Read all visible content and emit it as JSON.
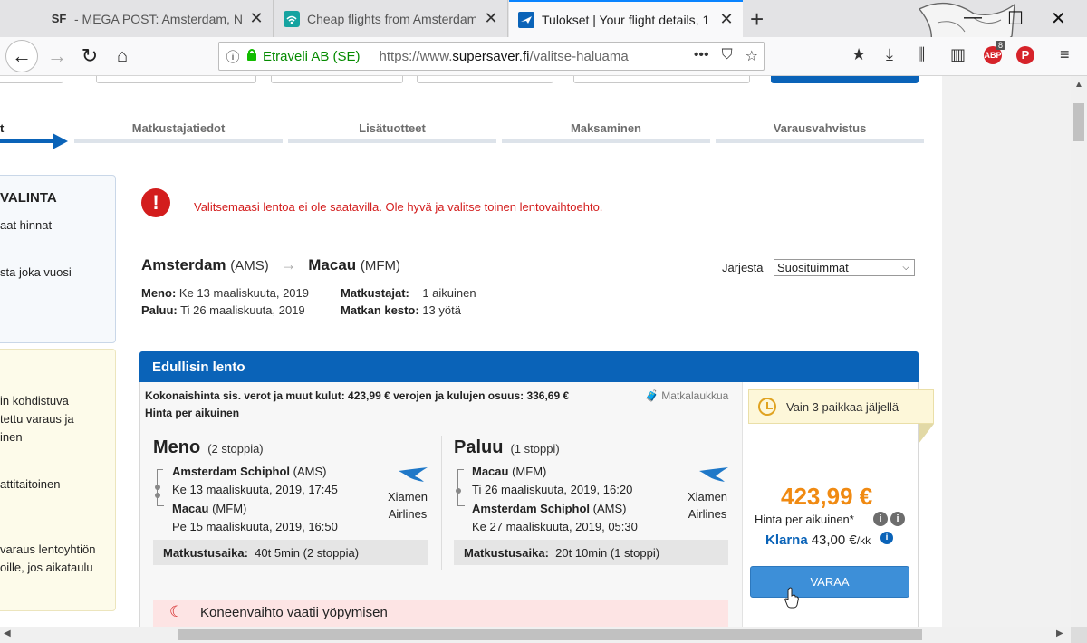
{
  "browser": {
    "tabs": [
      {
        "favicon": "SF",
        "title": "- MEGA POST: Amsterdam, Net"
      },
      {
        "favicon": "wifi-icon",
        "title": "Cheap flights from Amsterdam"
      },
      {
        "favicon": "plane-icon",
        "title": "Tulokset | Your flight details, 1"
      }
    ],
    "site_identity": "Etraveli AB (SE)",
    "url_prefix": "https://www.",
    "url_domain": "supersaver.fi",
    "url_path": "/valitse-haluama",
    "addon_badge": "8"
  },
  "steps": {
    "active": "t",
    "items": [
      "Matkustajatiedot",
      "Lisätuotteet",
      "Maksaminen",
      "Varausvahvistus"
    ]
  },
  "sidebar": {
    "box1": [
      "VALINTA",
      "aat hinnat",
      "sta joka vuosi"
    ],
    "box2": [
      "in kohdistuva",
      "tettu varaus ja",
      "inen",
      "attitaitoinen",
      "varaus lentoyhtiön",
      "oille, jos aikataulu"
    ]
  },
  "alert": {
    "message": "Valitsemaasi lentoa ei ole saatavilla. Ole hyvä ja valitse toinen lentovaihtoehto."
  },
  "route": {
    "from": "Amsterdam",
    "from_code": "(AMS)",
    "to": "Macau",
    "to_code": "(MFM)"
  },
  "sort": {
    "label": "Järjestä",
    "value": "Suosituimmat"
  },
  "trip_meta": {
    "depart_label": "Meno:",
    "depart_value": "Ke 13 maaliskuuta, 2019",
    "return_label": "Paluu:",
    "return_value": "Ti 26 maaliskuuta, 2019",
    "travellers_label": "Matkustajat:",
    "travellers_value": "1 aikuinen",
    "duration_label": "Matkan kesto:",
    "duration_value": "13 yötä"
  },
  "offer": {
    "header": "Edullisin lento",
    "total_line": "Kokonaishinta sis. verot ja muut kulut: 423,99 € verojen ja kulujen osuus: 336,69 €",
    "per_adult": "Hinta per aikuinen",
    "luggage": "Matkalaukkua",
    "outbound": {
      "title": "Meno",
      "stops": "(2 stoppia)",
      "from_name": "Amsterdam Schiphol",
      "from_code": "(AMS)",
      "depart": "Ke 13 maaliskuuta, 2019, 17:45",
      "to_name": "Macau",
      "to_code": "(MFM)",
      "arrive": "Pe 15 maaliskuuta, 2019, 16:50",
      "airline_line1": "Xiamen",
      "airline_line2": "Airlines",
      "duration_label": "Matkustusaika:",
      "duration_value": "40t 5min (2 stoppia)"
    },
    "inbound": {
      "title": "Paluu",
      "stops": "(1 stoppi)",
      "from_name": "Macau",
      "from_code": "(MFM)",
      "depart": "Ti 26 maaliskuuta, 2019, 16:20",
      "to_name": "Amsterdam Schiphol",
      "to_code": "(AMS)",
      "arrive": "Ke 27 maaliskuuta, 2019, 05:30",
      "airline_line1": "Xiamen",
      "airline_line2": "Airlines",
      "duration_label": "Matkustusaika:",
      "duration_value": "20t 10min (1 stoppi)"
    },
    "overnight_notice": "Koneenvaihto vaatii yöpymisen",
    "seats_left": "Vain 3 paikkaa jäljellä",
    "price": "423,99 €",
    "price_per": "Hinta per aikuinen*",
    "klarna_brand": "Klarna",
    "klarna_amount": "43,00 €",
    "klarna_period": "/kk",
    "book_label": "VARAA"
  },
  "colors": {
    "primary": "#0a63b8",
    "price": "#f08a12",
    "alert": "#d31d1d"
  }
}
